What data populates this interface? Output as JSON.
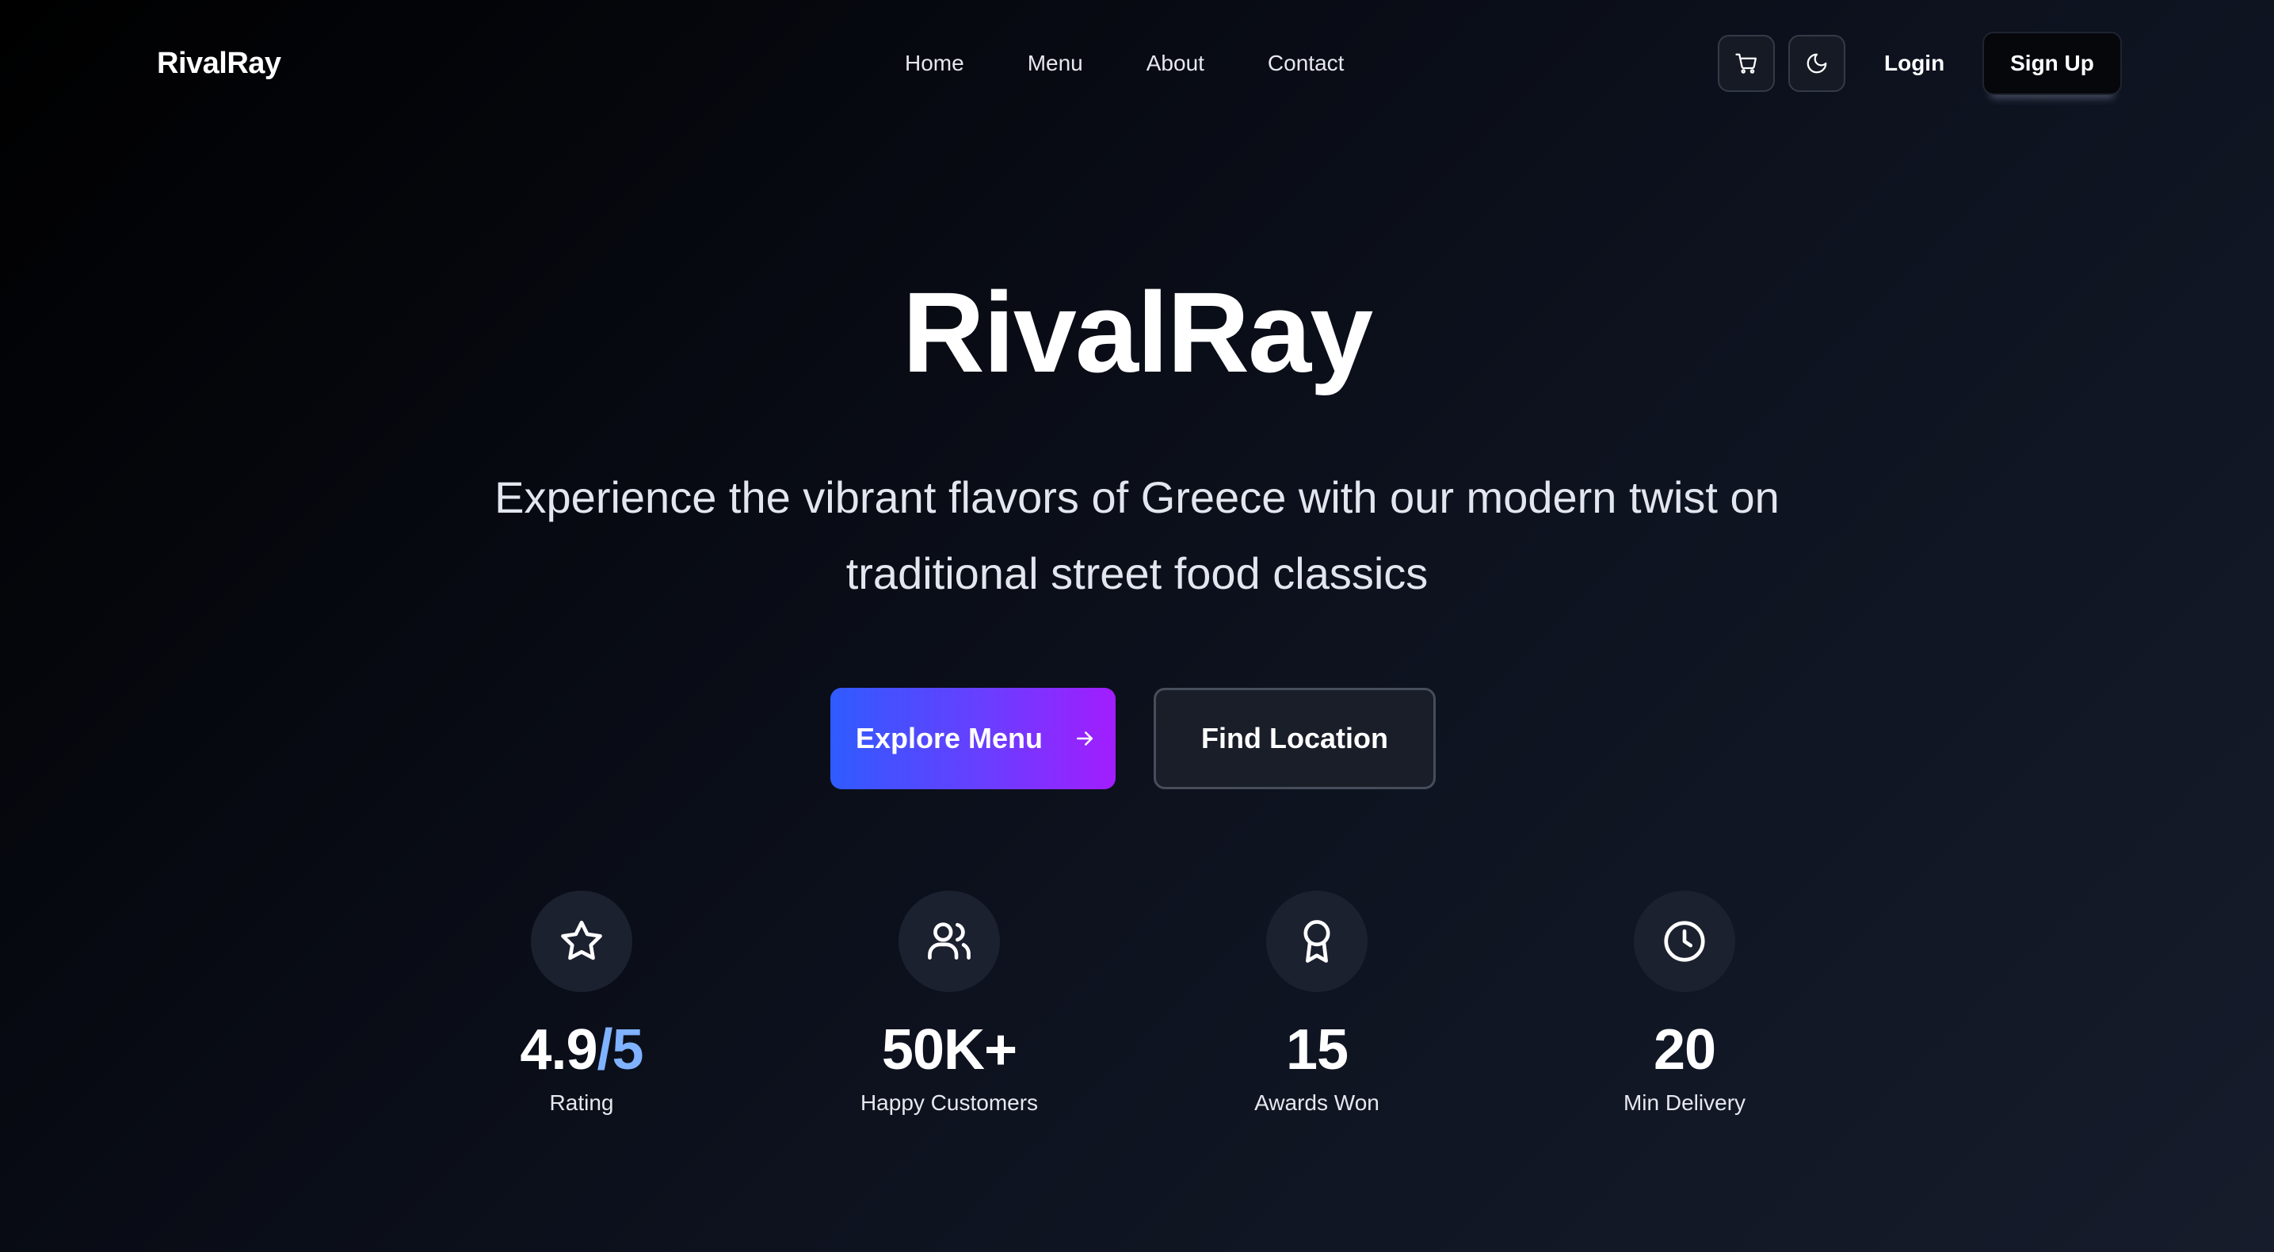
{
  "brand": {
    "name": "RivalRay"
  },
  "nav": {
    "links": [
      "Home",
      "Menu",
      "About",
      "Contact"
    ],
    "login_label": "Login",
    "signup_label": "Sign Up",
    "cart_icon": "shopping-cart-icon",
    "theme_icon": "moon-icon"
  },
  "hero": {
    "title": "RivalRay",
    "subtitle": "Experience the vibrant flavors of Greece with our modern twist on traditional street food classics",
    "primary_cta": "Explore Menu",
    "secondary_cta": "Find Location"
  },
  "stats": [
    {
      "icon": "star-icon",
      "value": "4.9",
      "value_accent": "/5",
      "label": "Rating"
    },
    {
      "icon": "users-icon",
      "value": "50K+",
      "value_accent": "",
      "label": "Happy Customers"
    },
    {
      "icon": "award-icon",
      "value": "15",
      "value_accent": "",
      "label": "Awards Won"
    },
    {
      "icon": "clock-icon",
      "value": "20",
      "value_accent": "",
      "label": "Min Delivery"
    }
  ],
  "colors": {
    "accent": "#7fb2ff",
    "gradient_start": "#2f5bff",
    "gradient_end": "#a21dff",
    "background_dark": "#000000"
  }
}
